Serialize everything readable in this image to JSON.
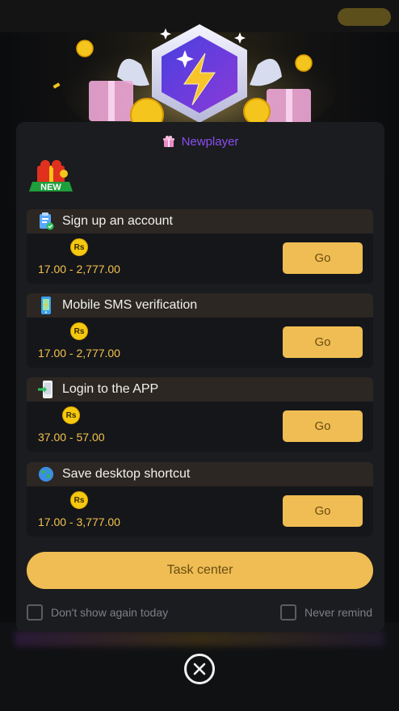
{
  "header": {
    "title": "Newplayer"
  },
  "badge": {
    "text": "NEW"
  },
  "tasks": [
    {
      "title": "Sign up an account",
      "icon": "clipboard-check-icon",
      "coin": "Rs",
      "range": "17.00 - 2,777.00",
      "button": "Go"
    },
    {
      "title": "Mobile SMS verification",
      "icon": "mobile-phone-icon",
      "coin": "Rs",
      "range": "17.00 - 2,777.00",
      "button": "Go"
    },
    {
      "title": "Login to the APP",
      "icon": "app-login-icon",
      "coin": "Rs",
      "range": "37.00 - 57.00",
      "button": "Go"
    },
    {
      "title": "Save desktop shortcut",
      "icon": "globe-icon",
      "coin": "Rs",
      "range": "17.00 - 3,777.00",
      "button": "Go"
    }
  ],
  "task_center": {
    "label": "Task center"
  },
  "options": {
    "dont_show": "Don't show again today",
    "never_remind": "Never remind"
  },
  "colors": {
    "accent": "#efbd53",
    "title_purple": "#8a4ef0",
    "range_text": "#f2c34d",
    "modal_bg": "#1b1c1f"
  }
}
